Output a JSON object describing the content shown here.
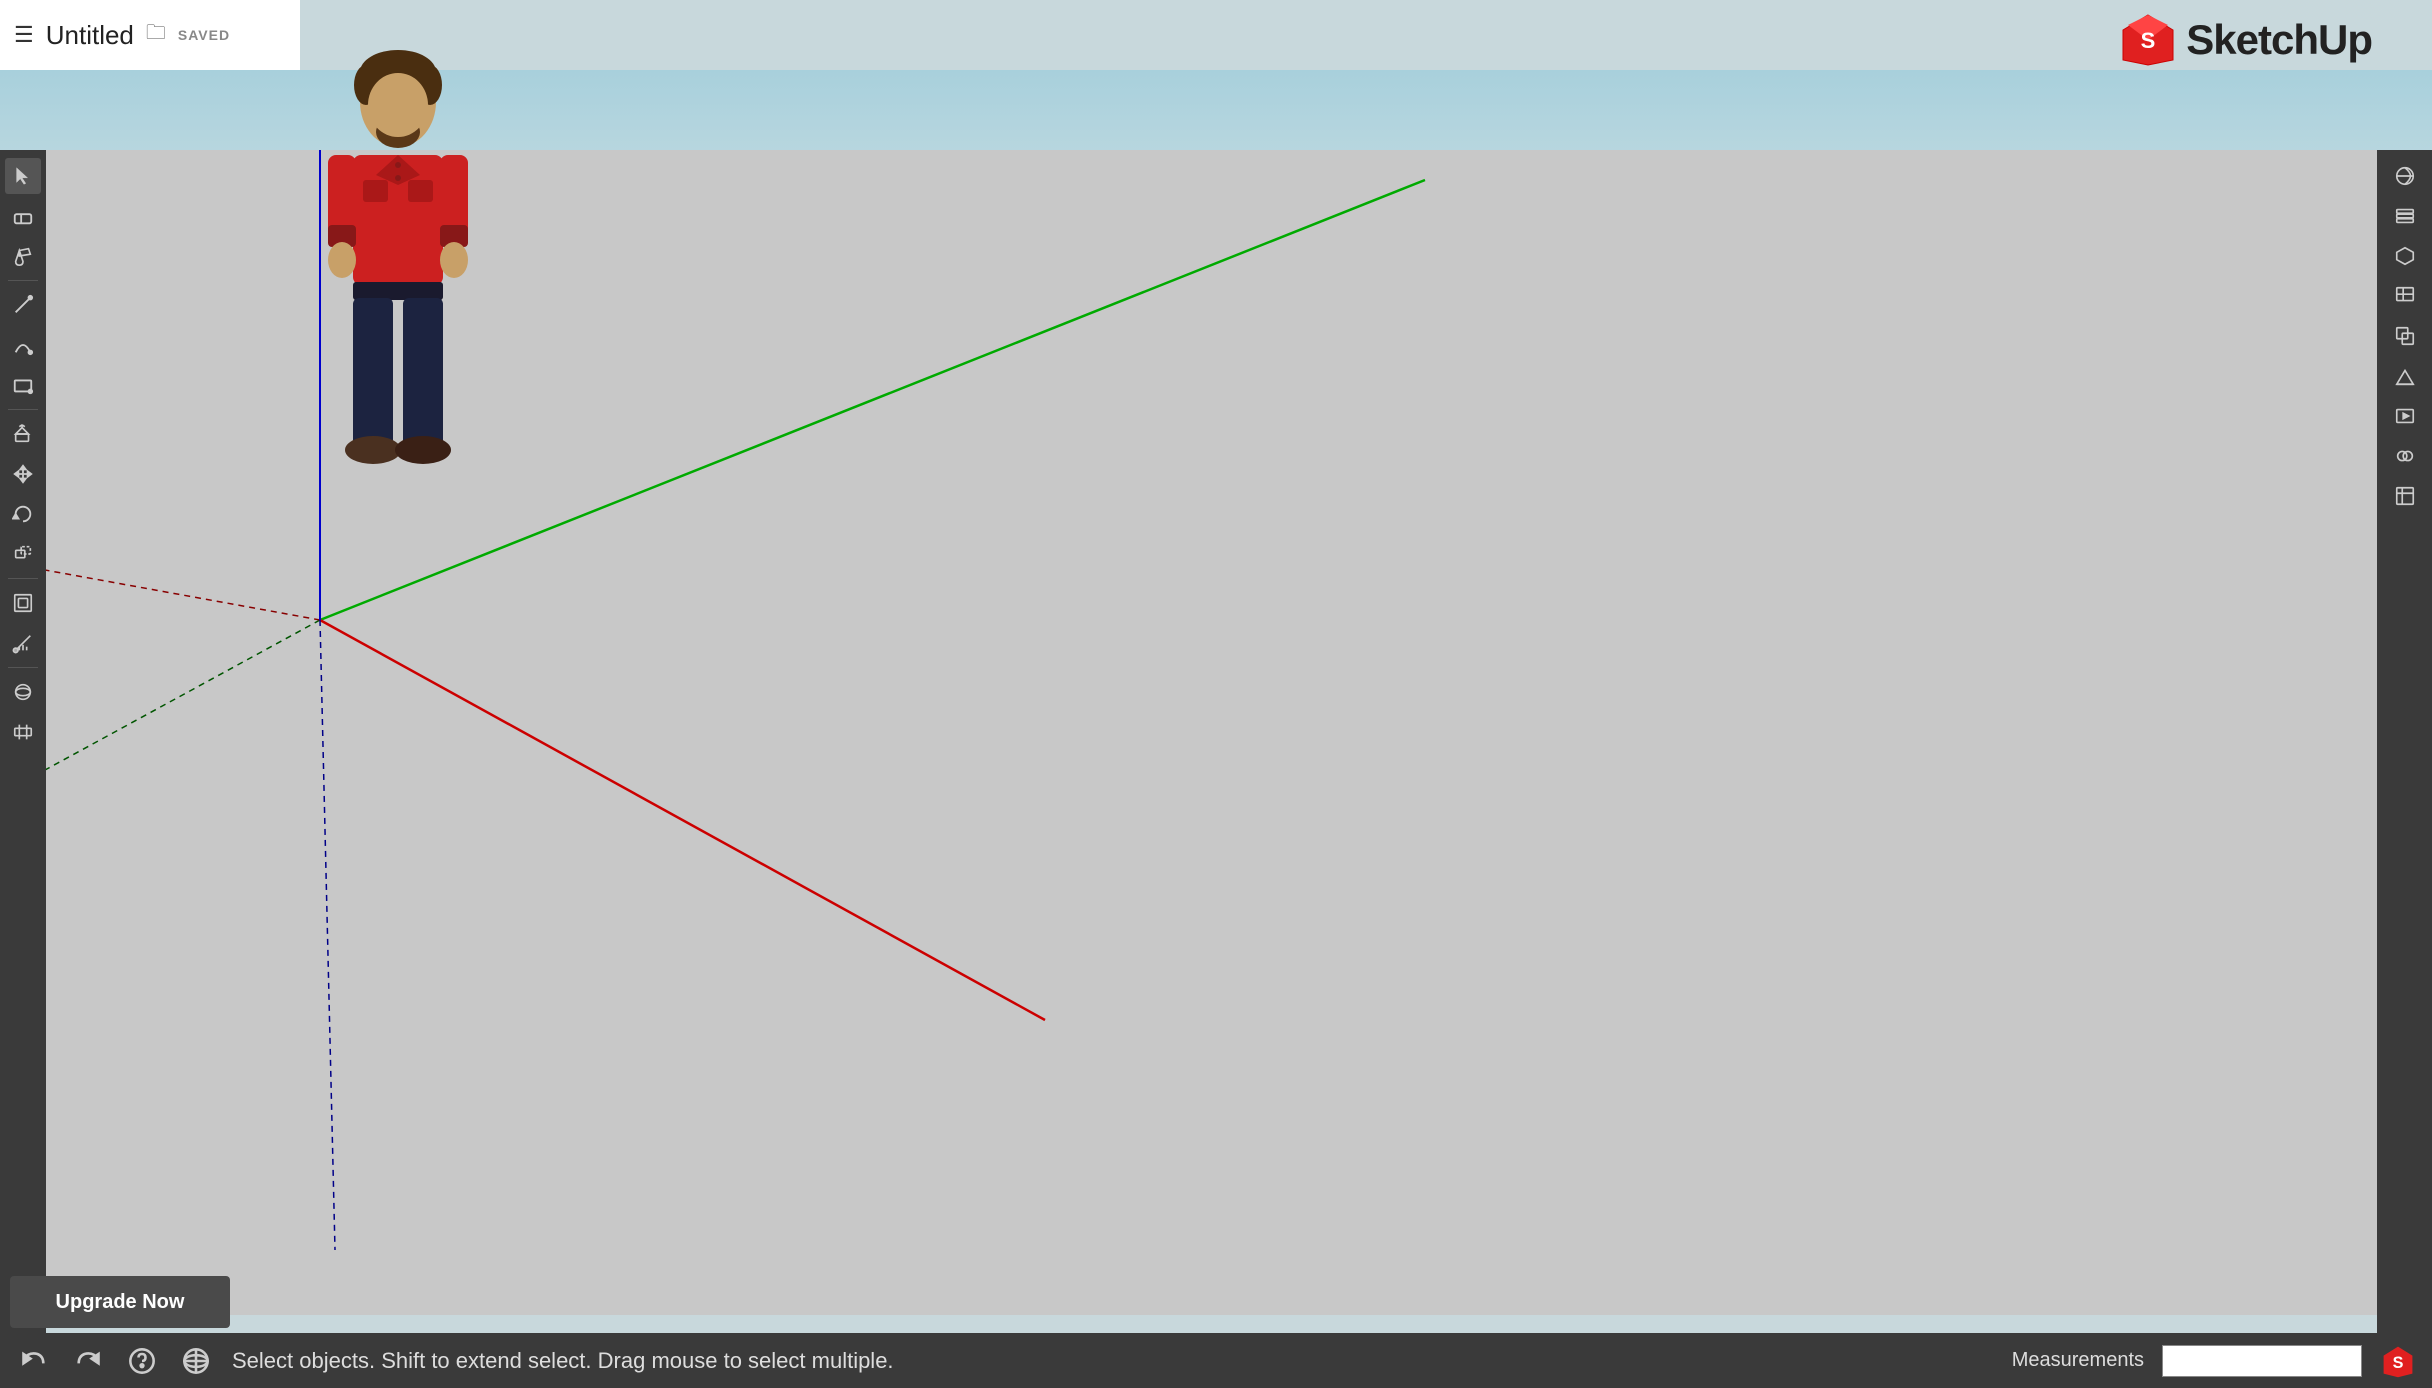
{
  "topbar": {
    "title": "Untitled",
    "saved_label": "SAVED"
  },
  "logo": {
    "text": "SketchUp"
  },
  "status_bar": {
    "text": "Select objects. Shift to extend select. Drag mouse to select multiple.",
    "measurements_label": "Measurements"
  },
  "upgrade": {
    "label": "Upgrade Now"
  },
  "left_tools": [
    {
      "name": "select",
      "icon": "↖"
    },
    {
      "name": "eraser",
      "icon": "◻"
    },
    {
      "name": "paint",
      "icon": "◎"
    },
    {
      "name": "line",
      "icon": "/"
    },
    {
      "name": "arc",
      "icon": "⌒"
    },
    {
      "name": "shape",
      "icon": "▱"
    },
    {
      "name": "push-pull",
      "icon": "⬡"
    },
    {
      "name": "move",
      "icon": "✛"
    },
    {
      "name": "rotate",
      "icon": "↻"
    },
    {
      "name": "scale",
      "icon": "⤡"
    },
    {
      "name": "offset",
      "icon": "⬜"
    },
    {
      "name": "tape",
      "icon": "✏"
    },
    {
      "name": "orbit",
      "icon": "⊕"
    },
    {
      "name": "section",
      "icon": "⊞"
    }
  ],
  "right_tools": [
    {
      "name": "materials",
      "icon": "◈"
    },
    {
      "name": "layers",
      "icon": "≡"
    },
    {
      "name": "components",
      "icon": "⬡"
    },
    {
      "name": "3d-warehouse",
      "icon": "◫"
    },
    {
      "name": "solid-tools",
      "icon": "◻"
    },
    {
      "name": "sandbox",
      "icon": "◿"
    },
    {
      "name": "scenes",
      "icon": "▶"
    },
    {
      "name": "styles",
      "icon": "∞"
    },
    {
      "name": "extension-manager",
      "icon": "⊞"
    }
  ],
  "colors": {
    "toolbar_bg": "#3a3a3a",
    "canvas_bg": "#c8c8c8",
    "sky_top": "#a8d0dc",
    "sky_bottom": "#c8dde2",
    "axis_green": "#00aa00",
    "axis_red": "#cc0000",
    "axis_blue": "#0000cc",
    "axis_green_dotted": "#006600",
    "axis_red_dotted": "#880000",
    "axis_blue_dotted": "#000088"
  }
}
